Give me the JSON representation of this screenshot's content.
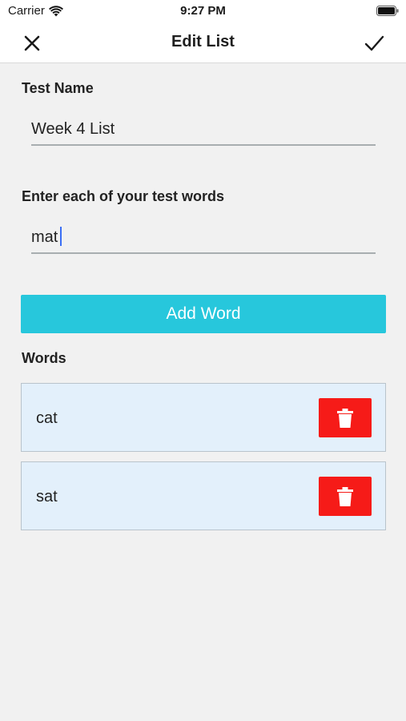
{
  "status_bar": {
    "carrier": "Carrier",
    "time": "9:27 PM",
    "icons": [
      "wifi-icon",
      "battery-icon"
    ]
  },
  "nav": {
    "title": "Edit List",
    "left_icon": "close-icon",
    "right_icon": "checkmark-icon"
  },
  "form": {
    "test_name_label": "Test Name",
    "test_name_value": "Week 4 List",
    "words_entry_label": "Enter each of your test words",
    "word_entry_value": "mat",
    "add_button_label": "Add Word"
  },
  "words_section": {
    "heading": "Words",
    "items": [
      {
        "word": "cat",
        "action_icon": "trash-icon"
      },
      {
        "word": "sat",
        "action_icon": "trash-icon"
      }
    ]
  },
  "colors": {
    "add_button": "#27c7dc",
    "delete_button": "#f61b18",
    "word_row_bg": "#e3f0fb",
    "caret": "#3b6ff5"
  }
}
